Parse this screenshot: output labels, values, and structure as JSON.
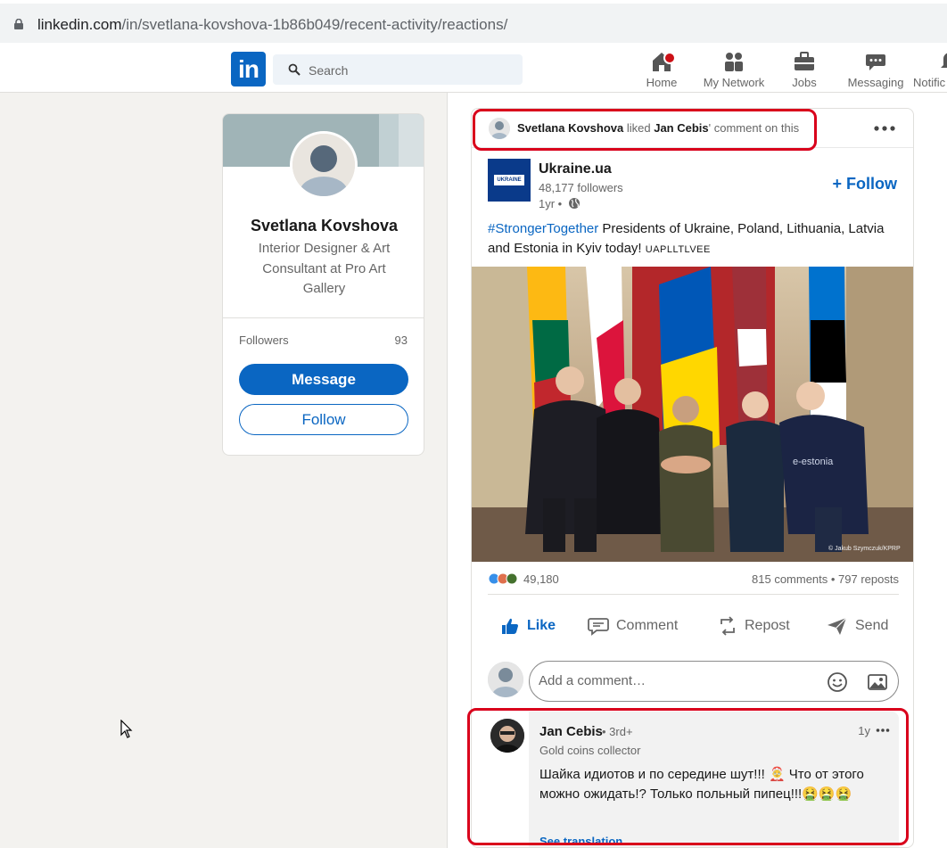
{
  "browser": {
    "url_host": "linkedin.com",
    "url_path": "/in/svetlana-kovshova-1b86b049/recent-activity/reactions/"
  },
  "nav": {
    "logo": "in",
    "search_placeholder": "Search",
    "items": [
      {
        "label": "Home",
        "icon": "home-icon"
      },
      {
        "label": "My Network",
        "icon": "network-icon"
      },
      {
        "label": "Jobs",
        "icon": "briefcase-icon"
      },
      {
        "label": "Messaging",
        "icon": "messaging-icon"
      },
      {
        "label": "Notific",
        "icon": "bell-icon"
      }
    ]
  },
  "profile": {
    "name": "Svetlana Kovshova",
    "headline": "Interior Designer & Art Consultant at Pro Art Gallery",
    "followers_label": "Followers",
    "followers_count": "93",
    "message_label": "Message",
    "follow_label": "Follow"
  },
  "activity": {
    "actor": "Svetlana Kovshova",
    "verb": "liked",
    "target": "Jan Cebis",
    "rest": "' comment on this"
  },
  "post": {
    "org_name": "Ukraine.ua",
    "org_logo_text": "UKRAINE",
    "org_followers": "48,177 followers",
    "time": "1yr •",
    "follow_label": "+ Follow",
    "hashtag": "#StrongerTogether",
    "text": " Presidents of Ukraine, Poland, Lithuania, Latvia and Estonia in Kyiv today! ",
    "flags_text": "UAPLLTLVEE",
    "image_credit": "© Jakub Szymczuk/KPRP",
    "sweater_text": "e-estonia",
    "reactions_count": "49,180",
    "comments_reposts": "815 comments • 797 reposts",
    "actions": {
      "like": "Like",
      "comment": "Comment",
      "repost": "Repost",
      "send": "Send"
    },
    "comment_placeholder": "Add a comment…"
  },
  "comment": {
    "author": "Jan Cebis",
    "degree": "• 3rd+",
    "subtitle": "Gold coins collector",
    "time": "1y",
    "text": "Шайка идиотов и по середине шут!!! 🤶 Что от этого можно ожидать!? Только польный пипец!!!🤮🤮🤮",
    "see_translation": "See translation"
  },
  "colors": {
    "brand": "#0a66c2",
    "highlight": "#d9001b"
  }
}
